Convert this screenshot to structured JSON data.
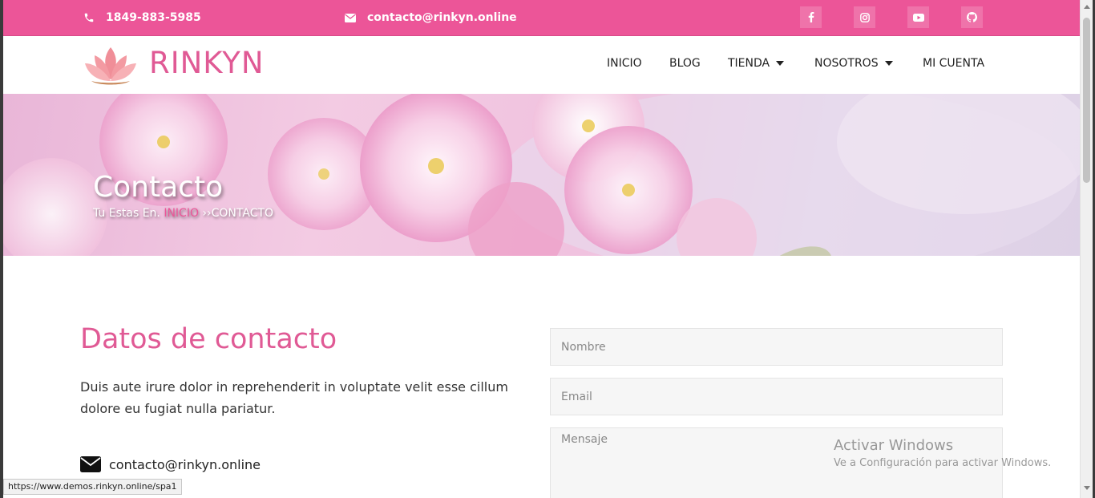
{
  "topbar": {
    "phone": "1849-883-5985",
    "email": "contacto@rinkyn.online",
    "social": [
      "facebook-icon",
      "instagram-icon",
      "youtube-icon",
      "github-icon"
    ]
  },
  "brand": {
    "name": "RINKYN"
  },
  "nav": {
    "items": [
      {
        "label": "INICIO"
      },
      {
        "label": "BLOG"
      },
      {
        "label": "TIENDA"
      },
      {
        "label": "NOSOTROS"
      },
      {
        "label": "MI CUENTA"
      }
    ]
  },
  "hero": {
    "title": "Contacto",
    "crumb_prefix": "Tu Estas En. ",
    "crumb_link": "INICIO",
    "crumb_suffix": " ››CONTACTO"
  },
  "contact": {
    "title": "Datos de contacto",
    "description": "Duis aute irure dolor in reprehenderit in voluptate velit esse cillum dolore eu fugiat nulla pariatur.",
    "email": "contacto@rinkyn.online"
  },
  "form": {
    "name_placeholder": "Nombre",
    "email_placeholder": "Email",
    "message_placeholder": "Mensaje"
  },
  "watermark": {
    "title": "Activar Windows",
    "subtitle": "Ve a Configuración para activar Windows."
  },
  "statusbar": {
    "url": "https://www.demos.rinkyn.online/spa1"
  },
  "colors": {
    "accent": "#ec5598",
    "brand_text": "#e05a95"
  }
}
